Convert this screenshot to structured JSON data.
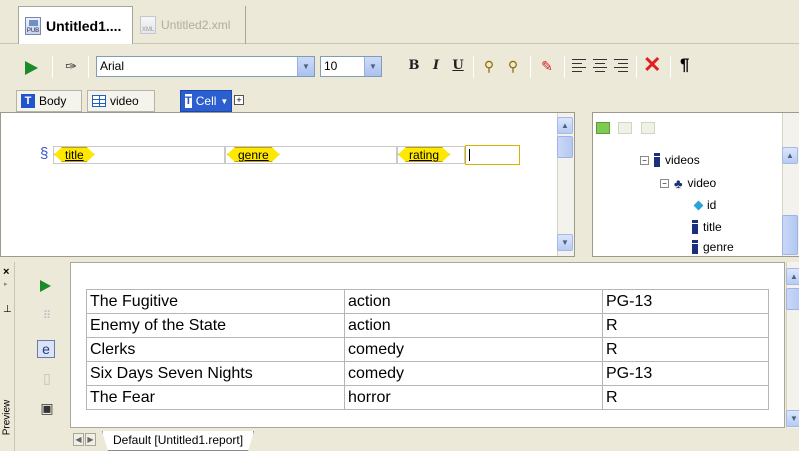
{
  "documents": {
    "tabs": [
      {
        "label": "Untitled1....",
        "icon": "report-doc-icon",
        "active": true
      },
      {
        "label": "Untitled2.xml",
        "icon": "xml-doc-icon",
        "active": false
      }
    ]
  },
  "toolbar": {
    "font_family": "Arial",
    "font_size": "10",
    "bold": "B",
    "italic": "I",
    "underline": "U",
    "paragraph": "¶"
  },
  "breadcrumb": [
    {
      "label": "Body",
      "icon": "text-t-icon"
    },
    {
      "label": "video",
      "icon": "table-grid-icon"
    },
    {
      "label": "Cell",
      "icon": "text-t-icon",
      "selected": true
    }
  ],
  "editor": {
    "tags": [
      "title",
      "genre",
      "rating"
    ]
  },
  "tree": {
    "nodes": [
      {
        "label": "videos",
        "level": 0
      },
      {
        "label": "video",
        "level": 1
      },
      {
        "label": "id",
        "level": 2
      },
      {
        "label": "title",
        "level": 2
      },
      {
        "label": "genre",
        "level": 2
      }
    ]
  },
  "preview": {
    "label": "Preview",
    "rows": [
      [
        "The Fugitive",
        "action",
        "PG-13"
      ],
      [
        "Enemy of the State",
        "action",
        "R"
      ],
      [
        "Clerks",
        "comedy",
        "R"
      ],
      [
        "Six Days Seven Nights",
        "comedy",
        "PG-13"
      ],
      [
        "The Fear",
        "horror",
        "R"
      ]
    ],
    "sheet_tab": "Default [Untitled1.report]"
  }
}
